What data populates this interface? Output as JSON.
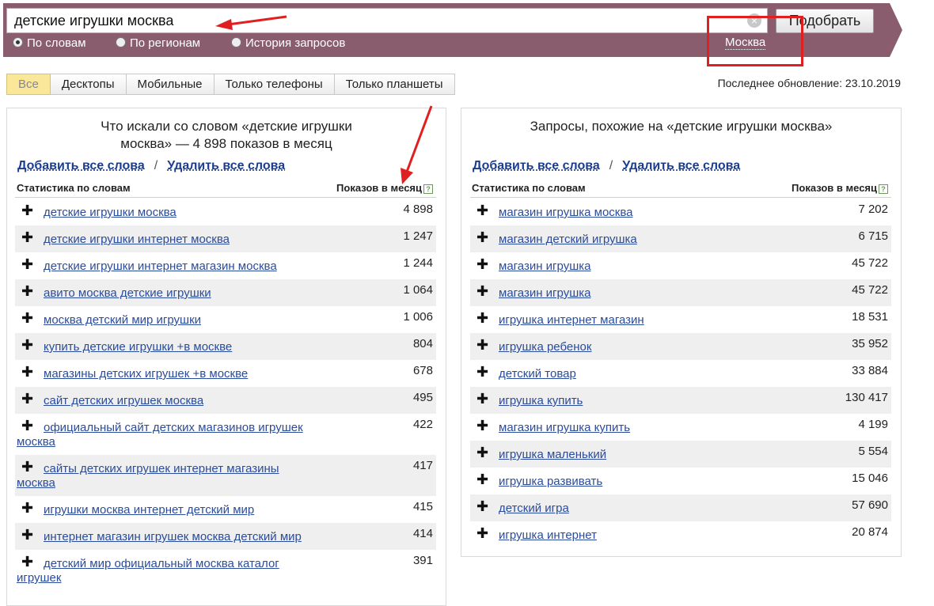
{
  "search": {
    "query": "детские игрушки москва",
    "clear_icon": "×",
    "pick_label": "Подобрать",
    "region": "Москва"
  },
  "modes": [
    {
      "label": "По словам",
      "checked": true
    },
    {
      "label": "По регионам",
      "checked": false
    },
    {
      "label": "История запросов",
      "checked": false
    }
  ],
  "tabs": [
    {
      "label": "Все",
      "active": true
    },
    {
      "label": "Десктопы"
    },
    {
      "label": "Мобильные"
    },
    {
      "label": "Только телефоны"
    },
    {
      "label": "Только планшеты"
    }
  ],
  "updated": "Последнее обновление: 23.10.2019",
  "left": {
    "title": "Что искали со словом «детские игрушки москва» — 4 898 показов в месяц",
    "add_all": "Добавить все слова",
    "remove_all": "Удалить все слова",
    "sep": "/",
    "col_words": "Статистика по словам",
    "col_count": "Показов в месяц",
    "help": "?",
    "rows": [
      {
        "kw": "детские игрушки москва",
        "count": "4 898"
      },
      {
        "kw": "детские игрушки интернет москва",
        "count": "1 247"
      },
      {
        "kw": "детские игрушки интернет магазин москва",
        "count": "1 244"
      },
      {
        "kw": "авито москва детские игрушки",
        "count": "1 064"
      },
      {
        "kw": "москва детский мир игрушки",
        "count": "1 006"
      },
      {
        "kw": "купить детские игрушки +в москве",
        "count": "804"
      },
      {
        "kw": "магазины детских игрушек +в москве",
        "count": "678"
      },
      {
        "kw": "сайт детских игрушек москва",
        "count": "495"
      },
      {
        "kw": "официальный сайт детских магазинов игрушек москва",
        "count": "422"
      },
      {
        "kw": "сайты детских игрушек интернет магазины москва",
        "count": "417"
      },
      {
        "kw": "игрушки москва интернет детский мир",
        "count": "415"
      },
      {
        "kw": "интернет магазин игрушек москва детский мир",
        "count": "414"
      },
      {
        "kw": "детский мир официальный москва каталог игрушек",
        "count": "391"
      }
    ]
  },
  "right": {
    "title": "Запросы, похожие на «детские игрушки москва»",
    "add_all": "Добавить все слова",
    "remove_all": "Удалить все слова",
    "sep": "/",
    "col_words": "Статистика по словам",
    "col_count": "Показов в месяц",
    "help": "?",
    "rows": [
      {
        "kw": "магазин игрушка москва",
        "count": "7 202"
      },
      {
        "kw": "магазин детский игрушка",
        "count": "6 715"
      },
      {
        "kw": "магазин игрушка",
        "count": "45 722"
      },
      {
        "kw": "магазин игрушка",
        "count": "45 722"
      },
      {
        "kw": "игрушка интернет магазин",
        "count": "18 531"
      },
      {
        "kw": "игрушка ребенок",
        "count": "35 952"
      },
      {
        "kw": "детский товар",
        "count": "33 884"
      },
      {
        "kw": "игрушка купить",
        "count": "130 417"
      },
      {
        "kw": "магазин игрушка купить",
        "count": "4 199"
      },
      {
        "kw": "игрушка маленький",
        "count": "5 554"
      },
      {
        "kw": "игрушка развивать",
        "count": "15 046"
      },
      {
        "kw": "детский игра",
        "count": "57 690"
      },
      {
        "kw": "игрушка интернет",
        "count": "20 874"
      }
    ]
  },
  "colors": {
    "bar": "#8a5d6e",
    "link": "#2b4c9a",
    "annotation": "#e02020",
    "active_tab": "#fbe79a"
  }
}
